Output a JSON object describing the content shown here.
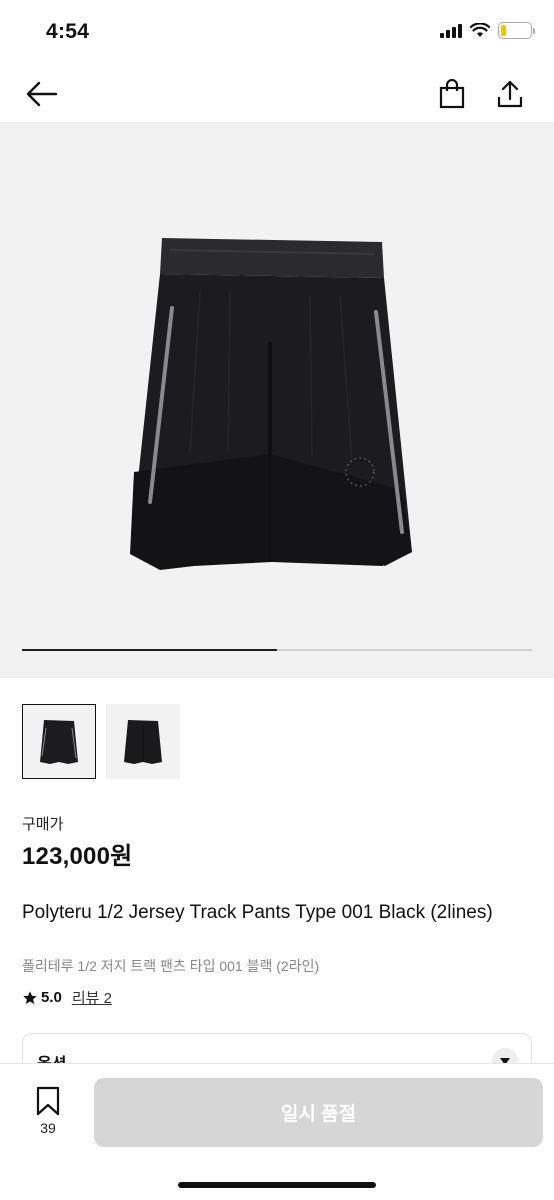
{
  "status": {
    "time": "4:54"
  },
  "gallery": {
    "progress_fraction": 0.5
  },
  "price": {
    "label": "구매가",
    "value": "123,000원"
  },
  "product": {
    "title_en": "Polyteru 1/2 Jersey Track Pants Type 001 Black (2lines)",
    "title_ko": "폴리테루 1/2 저지 트랙 팬츠 타입 001 블랙 (2라인)",
    "rating": "5.0",
    "review_link": "리뷰 2"
  },
  "option": {
    "label": "옵션"
  },
  "bottom": {
    "bookmark_count": "39",
    "button_label": "일시 품절"
  },
  "icons": [
    "back-arrow-icon",
    "shopping-bag-icon",
    "share-icon",
    "star-icon",
    "chevron-down-icon",
    "bookmark-icon"
  ],
  "colors": {
    "button_disabled": "#d6d6d6",
    "text": "#111111",
    "subtext": "#888888",
    "gallery_bg": "#f2f2f2"
  }
}
